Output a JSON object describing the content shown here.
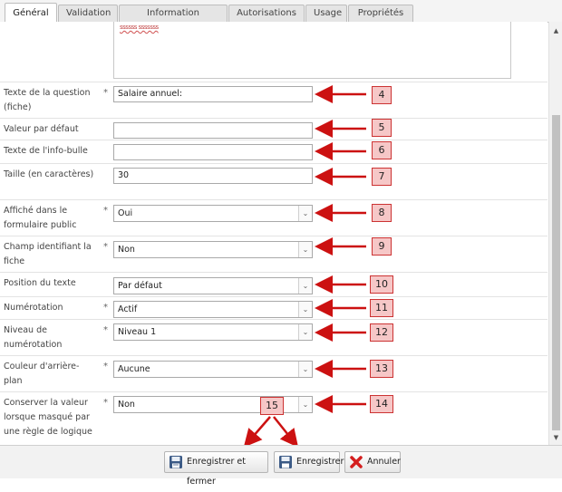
{
  "tabs": [
    {
      "label": "Général",
      "active": true
    },
    {
      "label": "Validation"
    },
    {
      "label": "Information système"
    },
    {
      "label": "Autorisations"
    },
    {
      "label": "Usage"
    },
    {
      "label": "Propriétés"
    }
  ],
  "textarea_content": "ssssss sssssss",
  "fields": {
    "question": {
      "label": "Texte de la question (fiche)",
      "required": "*",
      "value": "Salaire annuel:",
      "callout": "4"
    },
    "default": {
      "label": "Valeur par défaut",
      "value": "",
      "callout": "5"
    },
    "tooltip": {
      "label": "Texte de l'info-bulle",
      "value": "",
      "callout": "6"
    },
    "size": {
      "label": "Taille (en caractères)",
      "value": "30",
      "callout": "7"
    },
    "public": {
      "label": "Affiché dans le formulaire public",
      "required": "*",
      "value": "Oui",
      "callout": "8"
    },
    "identifier": {
      "label": "Champ identifiant la fiche",
      "required": "*",
      "value": "Non",
      "callout": "9"
    },
    "position": {
      "label": "Position du texte",
      "value": "Par défaut",
      "callout": "10"
    },
    "numbering": {
      "label": "Numérotation",
      "required": "*",
      "value": "Actif",
      "callout": "11"
    },
    "level": {
      "label": "Niveau de numérotation",
      "required": "*",
      "value": "Niveau 1",
      "callout": "12"
    },
    "background": {
      "label": "Couleur d'arrière-plan",
      "required": "*",
      "value": "Aucune",
      "callout": "13"
    },
    "keep": {
      "label": "Conserver la valeur lorsque masqué par une règle de logique",
      "required": "*",
      "value": "Non",
      "callout": "14"
    }
  },
  "footer": {
    "callout": "15",
    "save_close": "Enregistrer et fermer",
    "save": "Enregistrer",
    "cancel": "Annuler"
  },
  "colors": {
    "callout_fill": "#f6c7c7",
    "callout_border": "#cc3333",
    "arrow": "#cc1111"
  }
}
